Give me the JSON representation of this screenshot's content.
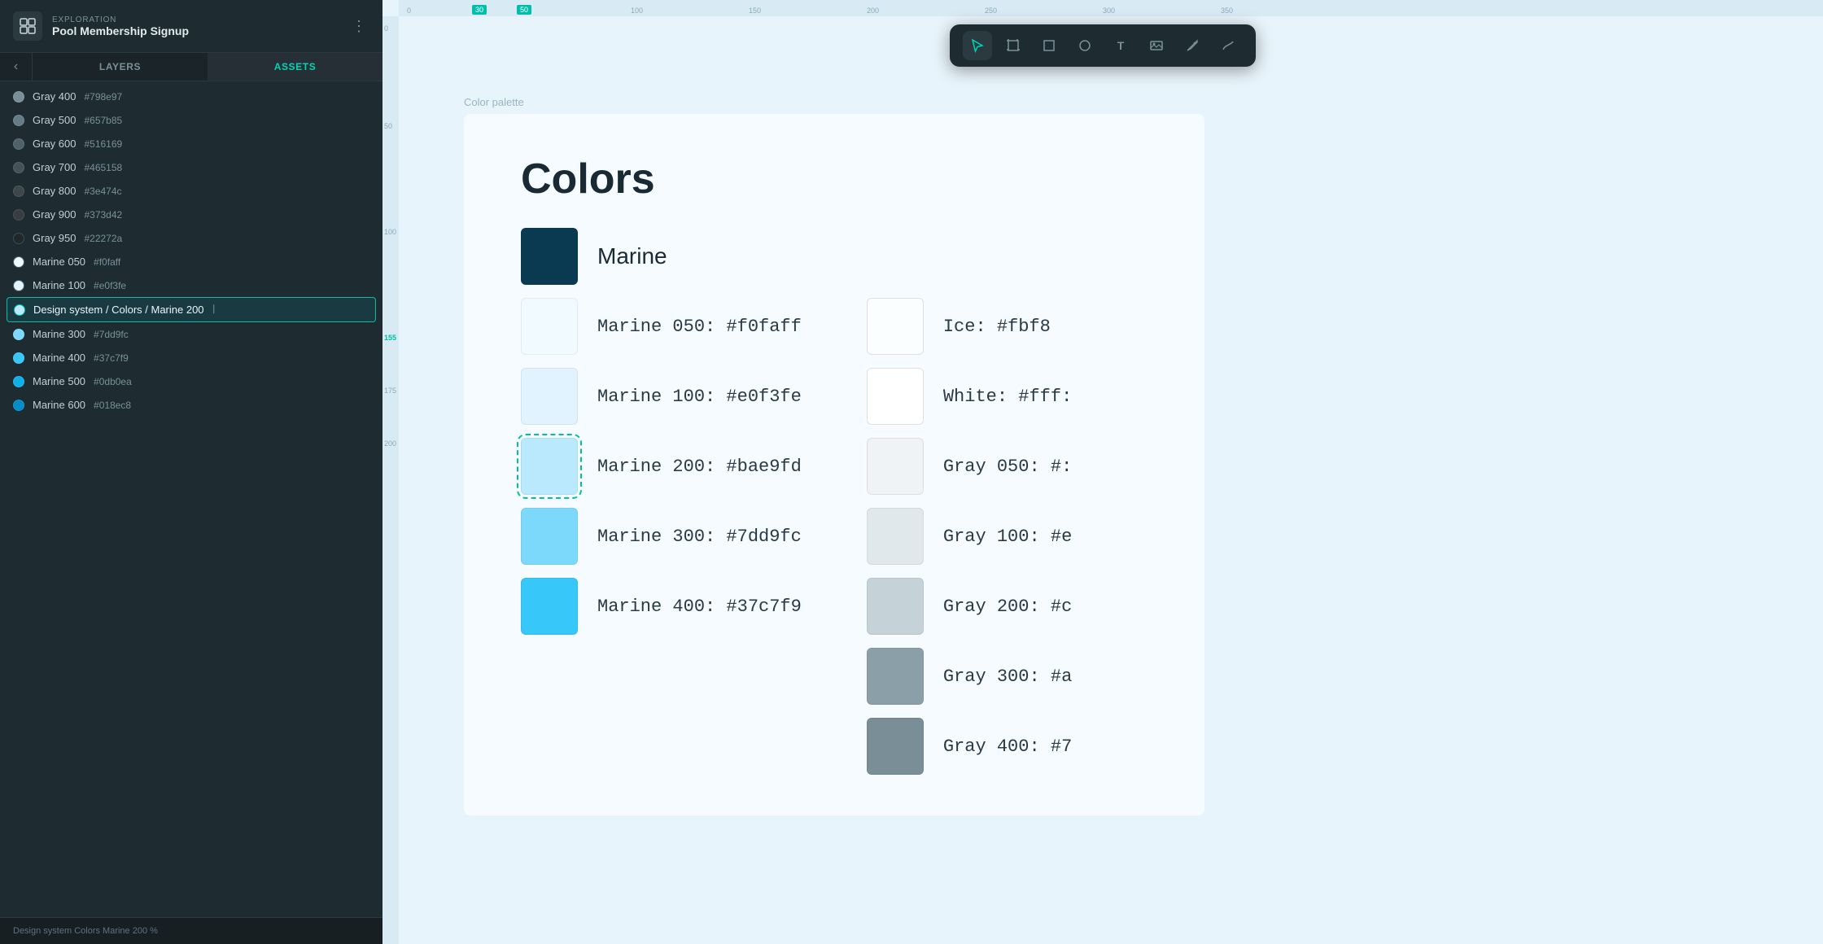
{
  "app": {
    "subtitle": "EXPLORATION",
    "title": "Pool Membership Signup",
    "menu_dots": "⋮"
  },
  "tabs": {
    "back_icon": "‹",
    "layers_label": "LAYERS",
    "assets_label": "ASSETS"
  },
  "layers": [
    {
      "id": "gray400",
      "color": "#798e97",
      "name": "Gray 400",
      "hex": "#798e97",
      "dot_style": "color"
    },
    {
      "id": "gray500",
      "color": "#657b85",
      "name": "Gray 500",
      "hex": "#657b85",
      "dot_style": "color"
    },
    {
      "id": "gray600",
      "color": "#516169",
      "name": "Gray 600",
      "hex": "#516169",
      "dot_style": "color"
    },
    {
      "id": "gray700",
      "color": "#465158",
      "name": "Gray 700",
      "hex": "#465158",
      "dot_style": "color"
    },
    {
      "id": "gray800",
      "color": "#3e474c",
      "name": "Gray 800",
      "hex": "#3e474c",
      "dot_style": "color"
    },
    {
      "id": "gray900",
      "color": "#373d42",
      "name": "Gray 900",
      "hex": "#373d42",
      "dot_style": "color"
    },
    {
      "id": "gray950",
      "color": "#22272a",
      "name": "Gray 950",
      "hex": "#22272a",
      "dot_style": "none"
    },
    {
      "id": "marine050",
      "color": "#f0faff",
      "name": "Marine 050",
      "hex": "#f0faff",
      "dot_style": "white"
    },
    {
      "id": "marine100",
      "color": "#e0f3fe",
      "name": "Marine 100",
      "hex": "#e0f3fe",
      "dot_style": "white"
    },
    {
      "id": "marine200",
      "color": "#bae9fd",
      "name": "Design system / Colors / Marine 200",
      "hex": "",
      "dot_style": "marine200",
      "selected": true
    },
    {
      "id": "marine300",
      "color": "#7dd9fc",
      "name": "Marine 300",
      "hex": "#7dd9fc",
      "dot_style": "color"
    },
    {
      "id": "marine400",
      "color": "#37c7f9",
      "name": "Marine 400",
      "hex": "#37c7f9",
      "dot_style": "color"
    },
    {
      "id": "marine500",
      "color": "#0db0ea",
      "name": "Marine 500",
      "hex": "#0db0ea",
      "dot_style": "color"
    },
    {
      "id": "marine600",
      "color": "#018ec8",
      "name": "Marine 600",
      "hex": "#018ec8",
      "dot_style": "color"
    }
  ],
  "toolbar": {
    "tools": [
      {
        "id": "select",
        "icon": "▷",
        "active": true
      },
      {
        "id": "frame",
        "icon": "⊡",
        "active": false
      },
      {
        "id": "rect",
        "icon": "□",
        "active": false
      },
      {
        "id": "ellipse",
        "icon": "○",
        "active": false
      },
      {
        "id": "text",
        "icon": "T",
        "active": false
      },
      {
        "id": "image",
        "icon": "⊞",
        "active": false
      },
      {
        "id": "pen",
        "icon": "✎",
        "active": false
      },
      {
        "id": "path",
        "icon": "∫",
        "active": false
      }
    ]
  },
  "ruler": {
    "top_marks": [
      "0",
      "30",
      "50",
      "100",
      "150",
      "200",
      "250",
      "300",
      "350"
    ],
    "highlighted": [
      "30",
      "50"
    ],
    "left_marks": [
      "0",
      "50",
      "100",
      "155",
      "175",
      "200"
    ]
  },
  "canvas": {
    "frame_label": "Color palette",
    "palette_title": "Colors",
    "marine_label": "Marine",
    "colors": [
      {
        "id": "marine050",
        "swatch": "#f0faff",
        "label": "Marine 050:  #f0faff",
        "selected": false
      },
      {
        "id": "marine100",
        "swatch": "#e0f3fe",
        "label": "Marine 100:  #e0f3fe",
        "selected": false
      },
      {
        "id": "marine200",
        "swatch": "#bae9fd",
        "label": "Marine 200:  #bae9fd",
        "selected": true
      },
      {
        "id": "marine300",
        "swatch": "#7dd9fc",
        "label": "Marine 300:  #7dd9fc",
        "selected": false
      },
      {
        "id": "marine400",
        "swatch": "#37c7f9",
        "label": "Marine 400:  #37c7f9",
        "selected": false
      }
    ],
    "right_colors": [
      {
        "id": "ice",
        "swatch": "#fbfeff",
        "label": "Ice:     #fbf8",
        "selected": false
      },
      {
        "id": "white",
        "swatch": "#ffffff",
        "label": "White:   #fff:",
        "selected": false
      },
      {
        "id": "gray050",
        "swatch": "#f5f8f9",
        "label": "Gray 050:  #:",
        "selected": false
      },
      {
        "id": "gray100",
        "swatch": "#e5eaec",
        "label": "Gray 100:  #e",
        "selected": false
      },
      {
        "id": "gray200",
        "swatch": "#c8d2d6",
        "label": "Gray 200:  #c",
        "selected": false
      },
      {
        "id": "gray300",
        "swatch": "#8a9fa8",
        "label": "Gray 300:  #a",
        "selected": false
      },
      {
        "id": "gray400",
        "swatch": "#798e97",
        "label": "Gray 400:  #7",
        "selected": false
      }
    ]
  },
  "bottom_bar": {
    "text": "Design system  Colors  Marine 200  %"
  }
}
